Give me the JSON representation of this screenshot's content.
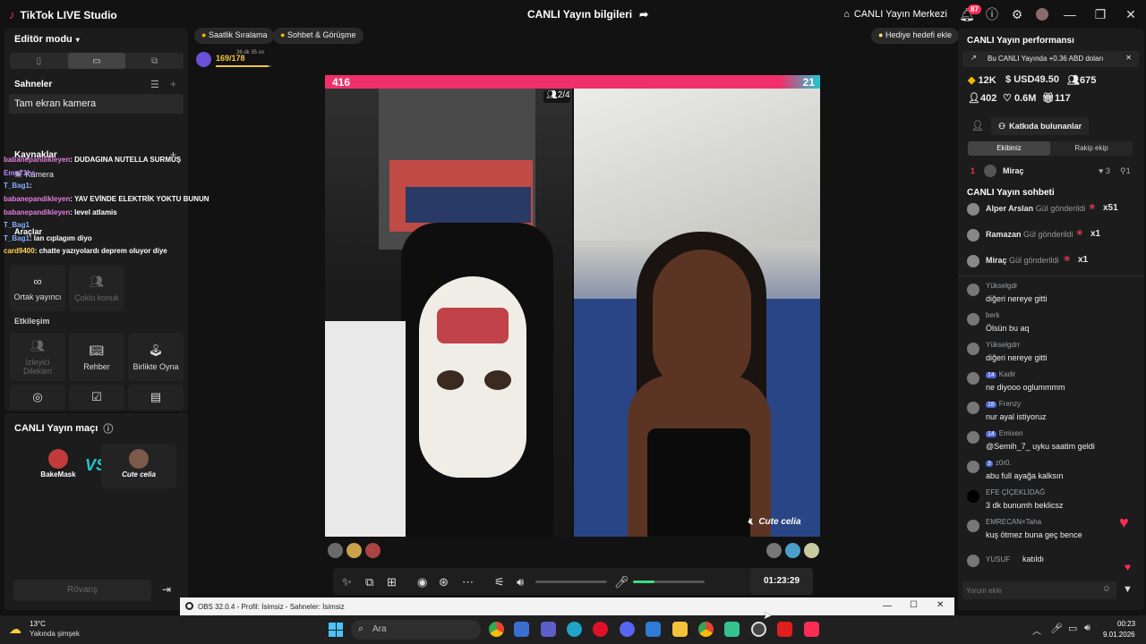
{
  "titlebar": {
    "app_name": "TikTok LIVE Studio",
    "center_title": "CANLI Yayın bilgileri",
    "live_center": "CANLI Yayın Merkezi",
    "notif_count": "87"
  },
  "left": {
    "editor_mode": "Editör modu",
    "scenes_title": "Sahneler",
    "scene_item": "Tam ekran kamera",
    "sources_title": "Kaynaklar",
    "source_camera": "Kamera",
    "tools_title": "Araçlar",
    "tools": [
      {
        "label": "Ortak yayıncı",
        "icon": "link-icon"
      },
      {
        "label": "Çoklu konuk",
        "icon": "users-icon"
      }
    ],
    "interaction_title": "Etkileşim",
    "interaction_tools": [
      {
        "label": "İzleyici Dilekleri",
        "icon": "users-icon"
      },
      {
        "label": "Rehber",
        "icon": "book-icon"
      },
      {
        "label": "Birlikte Oyna",
        "icon": "joystick-icon"
      }
    ],
    "overlay_chat": [
      {
        "user": "babanepandikleyen",
        "text": ": DUDAGINA NUTELLA SURMUŞ"
      },
      {
        "user": "Emo71hs",
        "text": ""
      },
      {
        "user": "T_Bag1",
        "text": ":"
      },
      {
        "user": "babanepandikleyen",
        "text": ": YAV EVİNDE ELEKTRİK YOKTU BUNUN"
      },
      {
        "user": "babanepandikleyen",
        "text": ": level atlamis"
      },
      {
        "user": "T_Bag1",
        "text": ""
      },
      {
        "user": "T_Bag1",
        "text": ": lan cıplagım diyo"
      },
      {
        "user": "card9400",
        "text": ": chatte yazıyolardı deprem oluyor diye"
      }
    ],
    "match_title": "CANLI Yayın maçı",
    "match_left": "BakeMask",
    "match_right": "Cute celia",
    "match_vs": "VS",
    "rematch": "Rövanş"
  },
  "center": {
    "pill_ranking": "Saatlik Sıralama",
    "pill_chat": "Sohbet & Görüşme",
    "gift_goal": "Hediye hedefi ekle",
    "level_progress": "169/178",
    "level_time": "36 dk 35 sn",
    "score_left": "416",
    "score_right": "21",
    "guests": "2/4",
    "countdown": "9s",
    "right_name": "Cute celia",
    "timer": "01:23:29",
    "mic_level": 0.3,
    "volume_level": 0.0
  },
  "right": {
    "perf_title": "CANLI Yayın performansı",
    "earning_banner": "Bu CANLI Yayında +0.36 ABD doları",
    "stats": [
      {
        "icon": "diamond-icon",
        "value": "12K"
      },
      {
        "icon": "dollar-icon",
        "value": "USD49.50"
      },
      {
        "icon": "viewers-icon",
        "value": "675"
      },
      {
        "icon": "person-icon",
        "value": "402"
      },
      {
        "icon": "heart-icon",
        "value": "0.6M"
      },
      {
        "icon": "gift-icon",
        "value": "117"
      }
    ],
    "contributors": "Katkıda bulunanlar",
    "tab_team": "Ekibiniz",
    "tab_rival": "Rakip ekip",
    "top_rank": "1",
    "top_name": "Miraç",
    "top_likes": "3",
    "top_gifts": "1",
    "chat_title": "CANLI Yayın sohbeti",
    "gifts": [
      {
        "user": "Alper Arslan",
        "action": "Gül gönderildi",
        "count": "x51"
      },
      {
        "user": "Ramazan",
        "action": "Gül gönderildi",
        "count": "x1"
      },
      {
        "user": "Miraç",
        "action": "Gül gönderildi",
        "count": "x1"
      }
    ],
    "messages": [
      {
        "user": "Yükselgdr",
        "level": "",
        "text": "diğeri nereye gitti"
      },
      {
        "user": "berk",
        "level": "",
        "text": "Ölsün bu aq"
      },
      {
        "user": "Yükselgdrr",
        "level": "",
        "text": "diğeri nereye gitti"
      },
      {
        "user": "Kadir",
        "level": "14",
        "text": "ne diyooo oglummmm"
      },
      {
        "user": "Frenzy",
        "level": "18",
        "text": "nur ayal istiyoruz"
      },
      {
        "user": "Emisen",
        "level": "14",
        "text": "@Semih_7_ uyku saatim geldi"
      },
      {
        "user": "z0r0.",
        "level": "3",
        "text": "abu full ayağa kalksın"
      },
      {
        "user": "EFE ÇİÇEKLİDAĞ",
        "level": "",
        "text": "3 dk bunumh beklicsz"
      },
      {
        "user": "EMRECAN×Taha",
        "level": "",
        "text": "kuş ötmez buna geç bence"
      },
      {
        "user": "YUSUF",
        "level": "",
        "text": "katıldı"
      }
    ],
    "comment_placeholder": "Yorum ekle"
  },
  "obs": {
    "title": "OBS 32.0.4 - Profil: İsimsiz - Sahneler: İsimsiz"
  },
  "taskbar": {
    "temp": "13°C",
    "weather": "Yakında şimşek",
    "search": "Ara",
    "time": "00:23",
    "date": "9.01.2026"
  },
  "colors": {
    "accent": "#fe2c55",
    "team_blue": "#22c6d4",
    "panel": "#1c1c1c"
  }
}
